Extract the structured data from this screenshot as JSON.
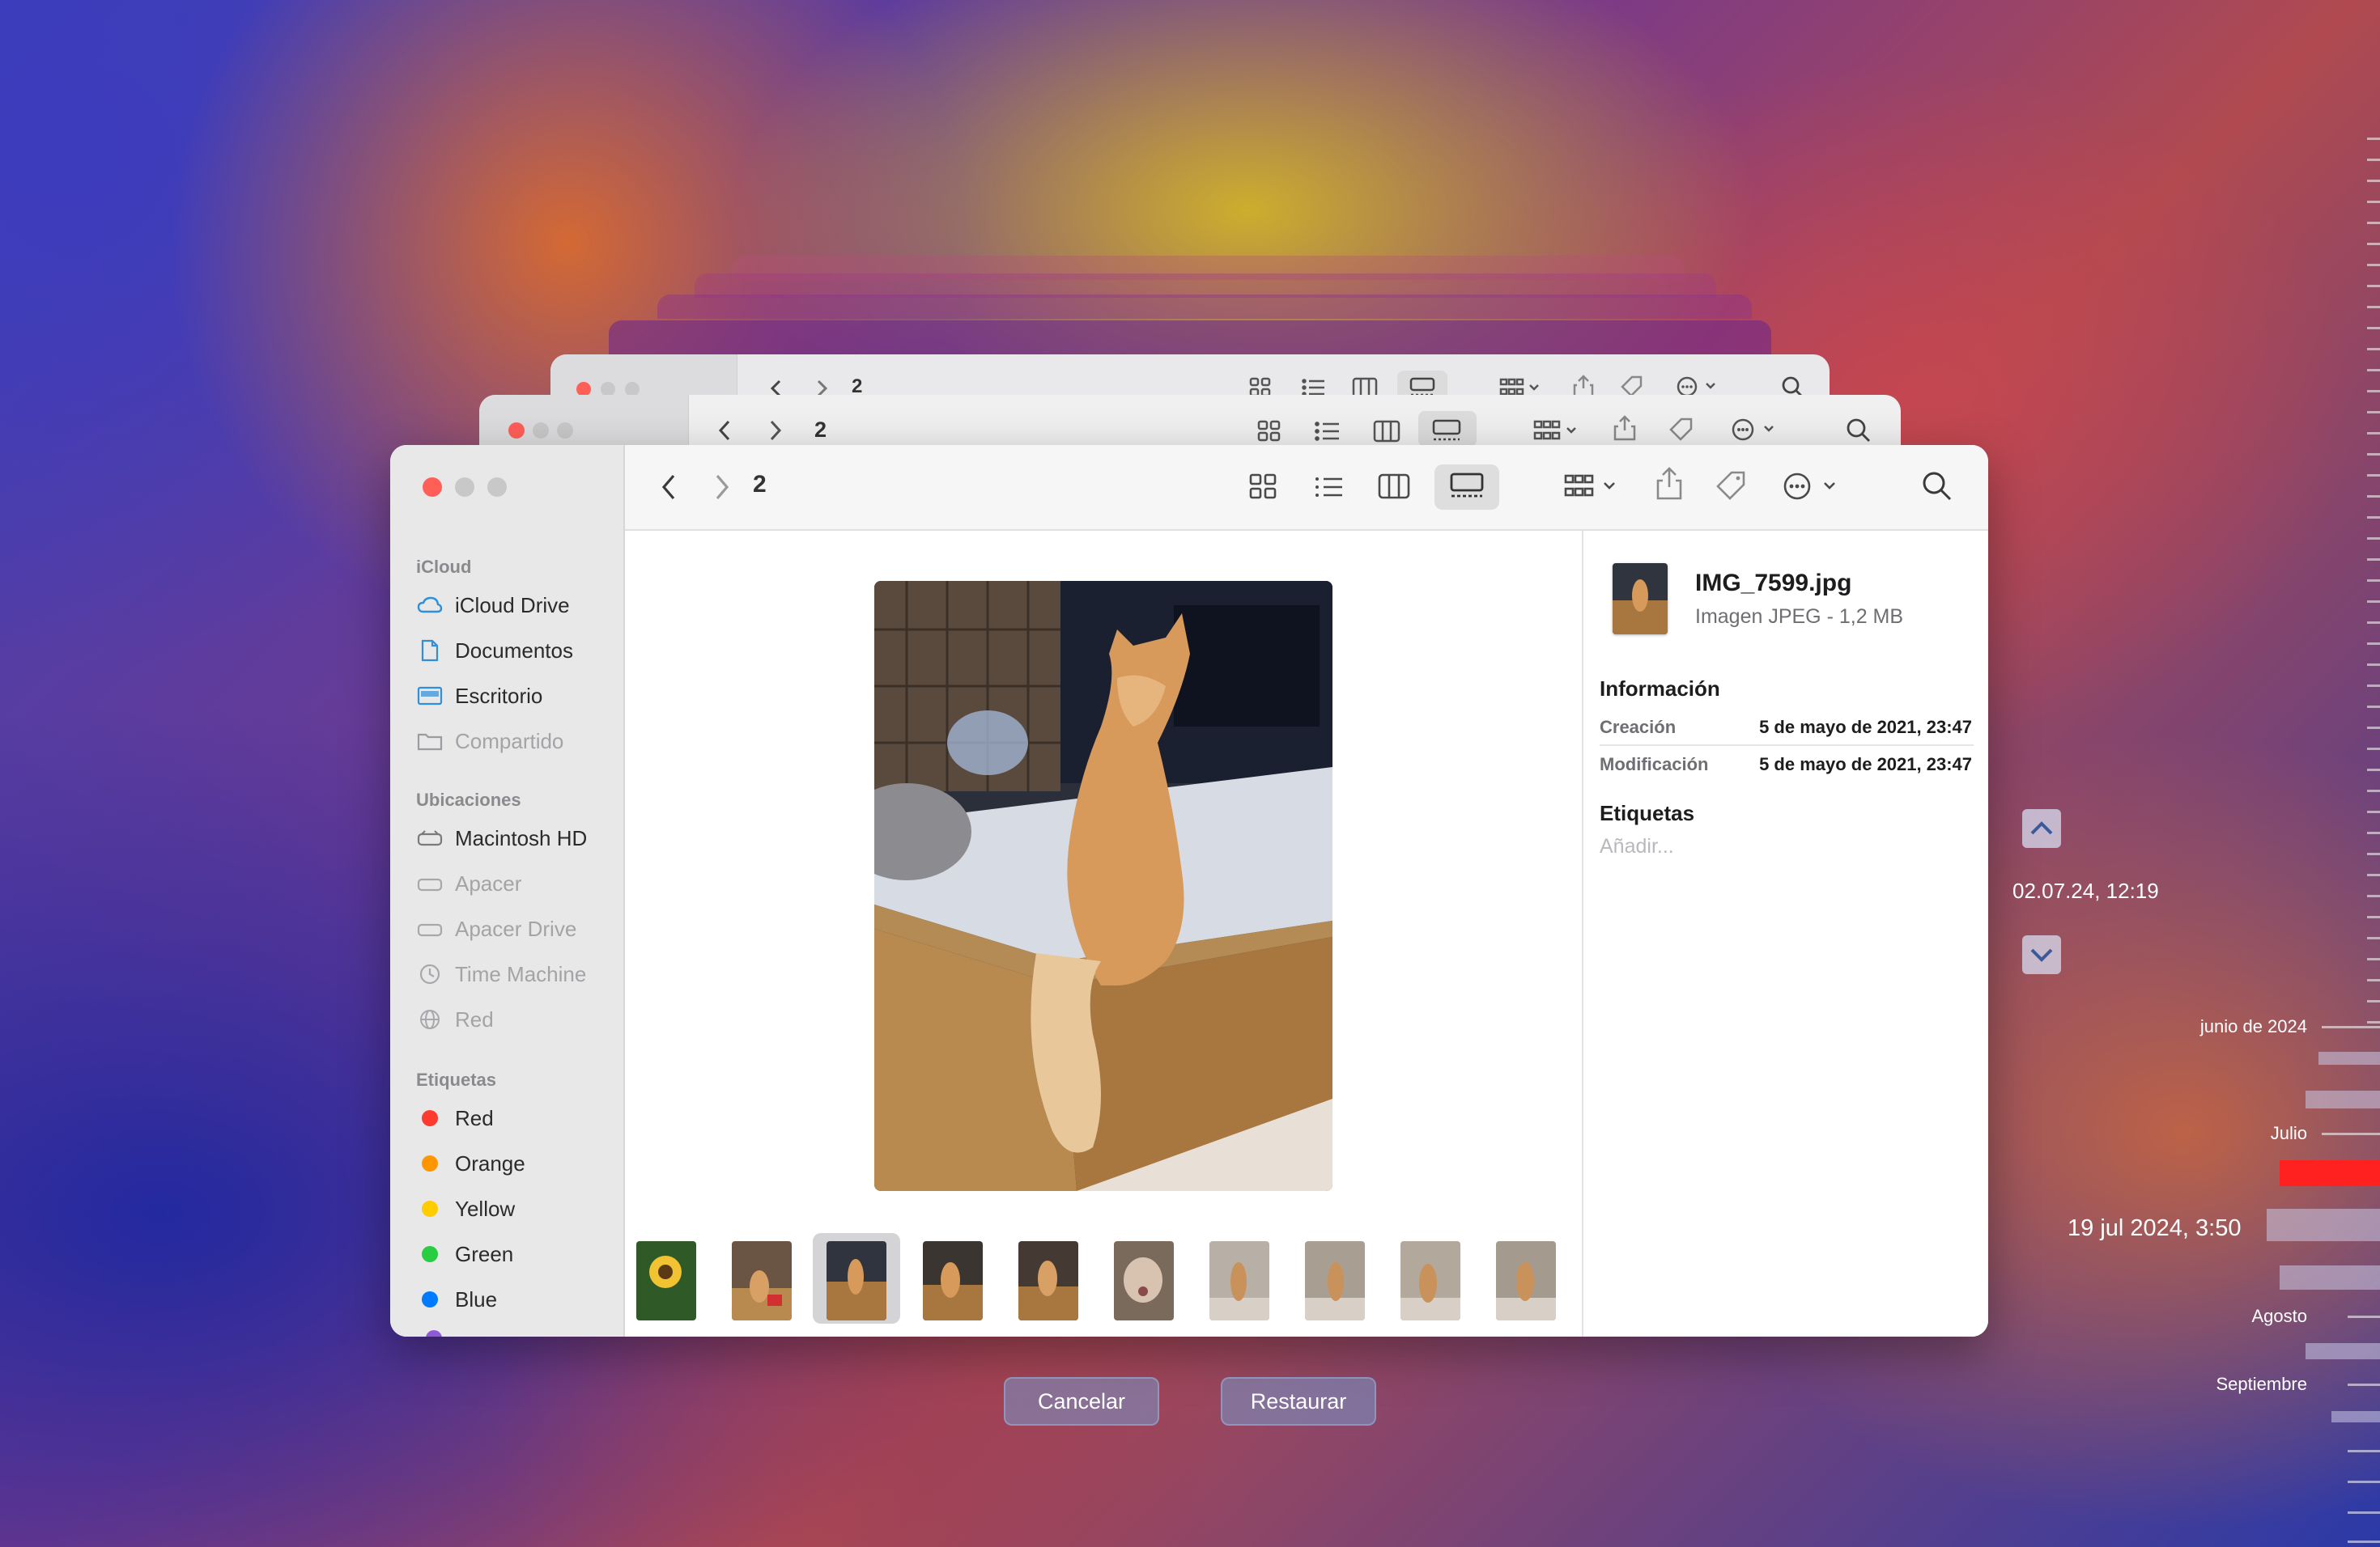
{
  "back_windows": [
    {
      "folder": "2"
    },
    {
      "folder": "2"
    }
  ],
  "toolbar": {
    "folder": "2"
  },
  "sidebar": {
    "sections": [
      {
        "title": "iCloud",
        "items": [
          {
            "label": "iCloud Drive",
            "icon": "cloud-icon",
            "dim": false
          },
          {
            "label": "Documentos",
            "icon": "document-icon",
            "dim": false
          },
          {
            "label": "Escritorio",
            "icon": "desktop-icon",
            "dim": false
          },
          {
            "label": "Compartido",
            "icon": "shared-folder-icon",
            "dim": true
          }
        ]
      },
      {
        "title": "Ubicaciones",
        "items": [
          {
            "label": "Macintosh HD",
            "icon": "drive-icon",
            "dim": false
          },
          {
            "label": "Apacer",
            "icon": "drive-icon",
            "dim": true
          },
          {
            "label": "Apacer Drive",
            "icon": "drive-icon",
            "dim": true
          },
          {
            "label": "Time Machine",
            "icon": "clock-icon",
            "dim": true
          },
          {
            "label": "Red",
            "icon": "globe-icon",
            "dim": true
          }
        ]
      },
      {
        "title": "Etiquetas",
        "items": [
          {
            "label": "Red",
            "color": "#ff3b30"
          },
          {
            "label": "Orange",
            "color": "#ff9500"
          },
          {
            "label": "Yellow",
            "color": "#ffcc00"
          },
          {
            "label": "Green",
            "color": "#28cd41"
          },
          {
            "label": "Blue",
            "color": "#007aff"
          }
        ]
      }
    ]
  },
  "info": {
    "filename": "IMG_7599.jpg",
    "filetype": "Imagen JPEG - 1,2 MB",
    "section_info": "Información",
    "rows": [
      {
        "key": "Creación",
        "value": "5 de mayo de 2021, 23:47"
      },
      {
        "key": "Modificación",
        "value": "5 de mayo de 2021, 23:47"
      }
    ],
    "section_tags": "Etiquetas",
    "tags_placeholder": "Añadir..."
  },
  "buttons": {
    "cancel": "Cancelar",
    "restore": "Restaurar"
  },
  "timeline": {
    "current_snapshot": "02.07.24, 12:19",
    "hover_date": "19 jul 2024, 3:50",
    "labels": [
      "junio de 2024",
      "Julio",
      "Agosto",
      "Septiembre"
    ],
    "accent": "#ff2020"
  }
}
